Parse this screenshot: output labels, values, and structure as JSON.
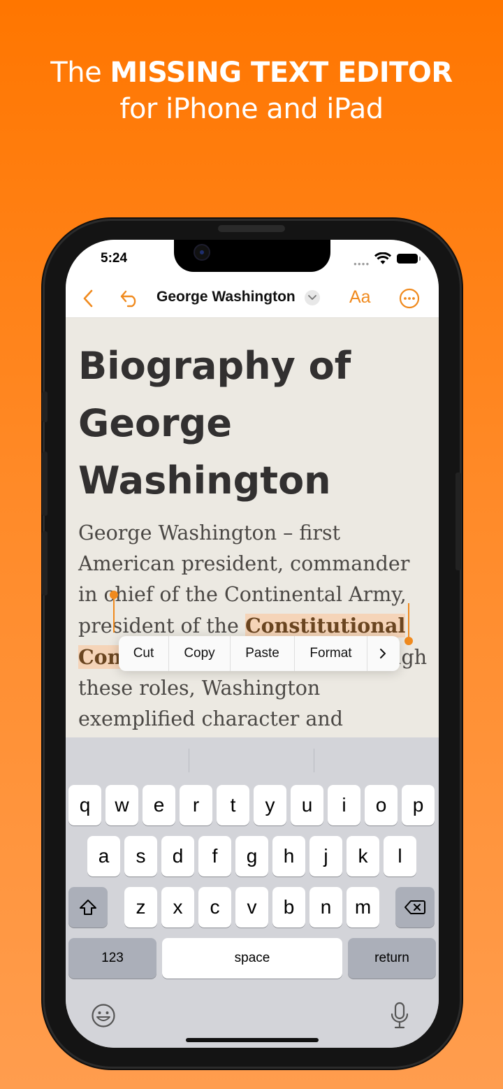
{
  "promo": {
    "line1_prefix": "The",
    "line1_bold": "MISSING TEXT EDITOR",
    "line2": "for iPhone and iPad"
  },
  "status_bar": {
    "time": "5:24",
    "signal_icon": "signal-dots-icon",
    "wifi_icon": "wifi-icon",
    "battery_icon": "battery-icon"
  },
  "nav_bar": {
    "back_icon": "chevron-left-icon",
    "undo_icon": "undo-arrow-icon",
    "title": "George Washington",
    "title_menu_icon": "chevron-down-icon",
    "format_label": "Aa",
    "more_icon": "ellipsis-circle-icon",
    "accent_color": "#f08a1e"
  },
  "document": {
    "heading": "Biography of George Washington",
    "body_before": "George Washington – first Ame",
    "body_hidden": "rican president, commander in chief of",
    "body_line3": " the Continental Army, president of the ",
    "selection": "Constitutional Convention",
    "body_after": ", and farmer. Through these roles, Washington exemplified character and leadership."
  },
  "edit_menu": {
    "items": [
      "Cut",
      "Copy",
      "Paste",
      "Format"
    ],
    "more_icon": "chevron-right-icon"
  },
  "keyboard": {
    "row1": [
      "q",
      "w",
      "e",
      "r",
      "t",
      "y",
      "u",
      "i",
      "o",
      "p"
    ],
    "row2": [
      "a",
      "s",
      "d",
      "f",
      "g",
      "h",
      "j",
      "k",
      "l"
    ],
    "row3": [
      "z",
      "x",
      "c",
      "v",
      "b",
      "n",
      "m"
    ],
    "shift_icon": "shift-arrow-icon",
    "delete_icon": "backspace-icon",
    "numbers_label": "123",
    "space_label": "space",
    "return_label": "return",
    "emoji_icon": "emoji-face-icon",
    "mic_icon": "microphone-icon"
  }
}
